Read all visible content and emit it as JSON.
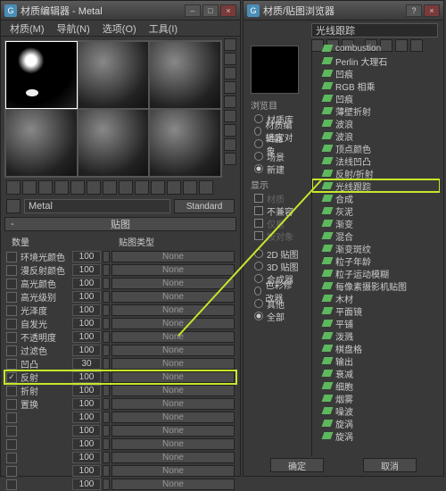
{
  "left_window": {
    "title": "材质编辑器 - Metal",
    "menu": [
      "材质(M)",
      "导航(N)",
      "选项(O)",
      "工具(I)"
    ],
    "material_name": "Metal",
    "material_type": "Standard",
    "maps_header": "贴图",
    "col_amount": "数量",
    "col_maptype": "贴图类型",
    "rows": [
      {
        "on": false,
        "label": "环境光颜色",
        "amt": "100",
        "slot": "None"
      },
      {
        "on": false,
        "label": "漫反射颜色",
        "amt": "100",
        "slot": "None"
      },
      {
        "on": false,
        "label": "高光颜色",
        "amt": "100",
        "slot": "None"
      },
      {
        "on": false,
        "label": "高光级别",
        "amt": "100",
        "slot": "None"
      },
      {
        "on": false,
        "label": "光泽度",
        "amt": "100",
        "slot": "None"
      },
      {
        "on": false,
        "label": "自发光",
        "amt": "100",
        "slot": "None"
      },
      {
        "on": false,
        "label": "不透明度",
        "amt": "100",
        "slot": "None"
      },
      {
        "on": false,
        "label": "过滤色",
        "amt": "100",
        "slot": "None"
      },
      {
        "on": false,
        "label": "凹凸",
        "amt": "30",
        "slot": "None"
      },
      {
        "on": true,
        "label": "反射",
        "amt": "100",
        "slot": "None",
        "hl": true
      },
      {
        "on": false,
        "label": "折射",
        "amt": "100",
        "slot": "None"
      },
      {
        "on": false,
        "label": "置换",
        "amt": "100",
        "slot": "None"
      },
      {
        "on": false,
        "label": "",
        "amt": "100",
        "slot": "None"
      },
      {
        "on": false,
        "label": "",
        "amt": "100",
        "slot": "None"
      },
      {
        "on": false,
        "label": "",
        "amt": "100",
        "slot": "None"
      },
      {
        "on": false,
        "label": "",
        "amt": "100",
        "slot": "None"
      },
      {
        "on": false,
        "label": "",
        "amt": "100",
        "slot": "None"
      },
      {
        "on": false,
        "label": "",
        "amt": "100",
        "slot": "None"
      }
    ]
  },
  "right_window": {
    "title": "材质/贴图浏览器",
    "search": "光线跟踪",
    "browse_label": "浏览目",
    "browse_opts": [
      {
        "label": "材质库",
        "on": false
      },
      {
        "label": "材质编辑器",
        "on": false
      },
      {
        "label": "选定对象",
        "on": false
      },
      {
        "label": "场景",
        "on": false
      },
      {
        "label": "新建",
        "on": true
      }
    ],
    "show_label": "显示",
    "show_opts": [
      {
        "label": "材质",
        "dim": true
      },
      {
        "label": "不兼容",
        "dim": false
      },
      {
        "label": "仅根",
        "dim": true
      },
      {
        "label": "按对象",
        "dim": true
      }
    ],
    "radio2": [
      {
        "label": "2D 贴图",
        "on": false
      },
      {
        "label": "3D 贴图",
        "on": false
      },
      {
        "label": "合成器",
        "on": false
      },
      {
        "label": "色彩修改器",
        "on": false
      },
      {
        "label": "其他",
        "on": false
      },
      {
        "label": "全部",
        "on": true
      }
    ],
    "tree": [
      "combustion",
      "Perlin 大理石",
      "凹痕",
      "RGB 相乘",
      "凹痕",
      "薄壁折射",
      "波浪",
      "波浪",
      "顶点颜色",
      "法线凹凸",
      "反射/折射",
      "光线跟踪",
      "合成",
      "灰泥",
      "渐变",
      "混合",
      "渐变斑纹",
      "粒子年龄",
      "粒子运动模糊",
      "每像素摄影机贴图",
      "木材",
      "平面镜",
      "平铺",
      "泼溅",
      "棋盘格",
      "输出",
      "衰减",
      "细胞",
      "烟雾",
      "噪波",
      "旋涡",
      "旋涡"
    ],
    "tree_hl_index": 11,
    "ok": "确定",
    "cancel": "取消"
  }
}
